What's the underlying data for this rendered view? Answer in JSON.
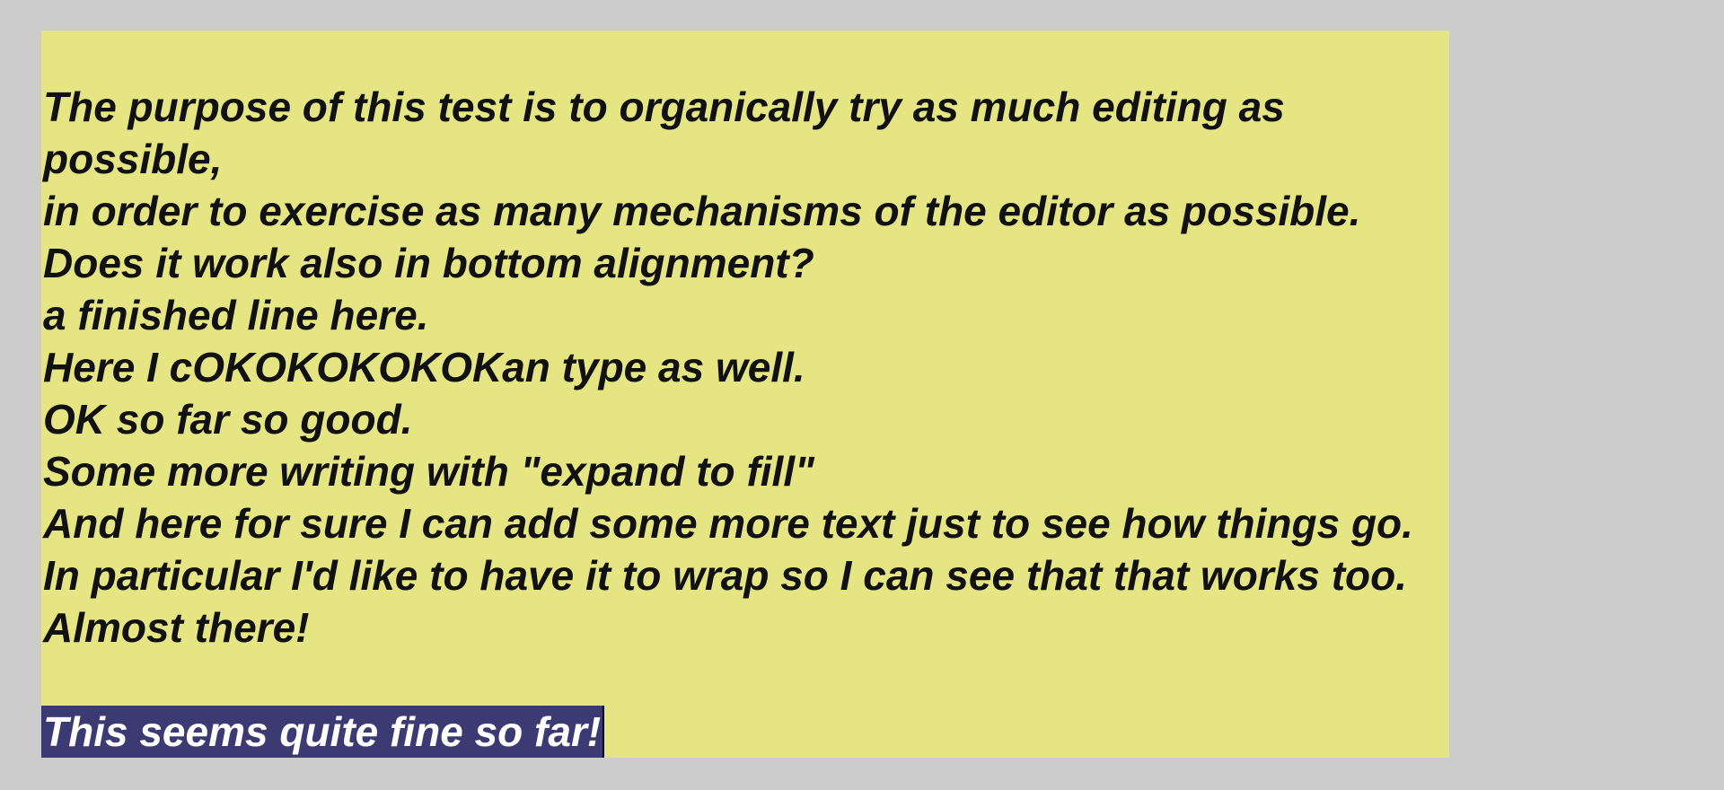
{
  "editor": {
    "lines": [
      "The purpose of this test is to organically try as much editing as possible,",
      "in order to exercise as many mechanisms of the editor as possible.",
      "Does it work also in bottom alignment?",
      "a finished line here.",
      "Here I cOKOKOKOKOKan type as well.",
      "OK so far so good.",
      "Some more writing with \"expand to fill\"",
      "And here for sure I can add some more text just to see how things go. In particular I'd like to have it to wrap so I can see that that works too. Almost there!"
    ],
    "selected_text": "This seems quite fine so far!",
    "colors": {
      "background": "#cccccc",
      "editor_background": "#e5e584",
      "text": "#111111",
      "selection": "#3b3a72",
      "selection_text": "#ffffff"
    }
  }
}
